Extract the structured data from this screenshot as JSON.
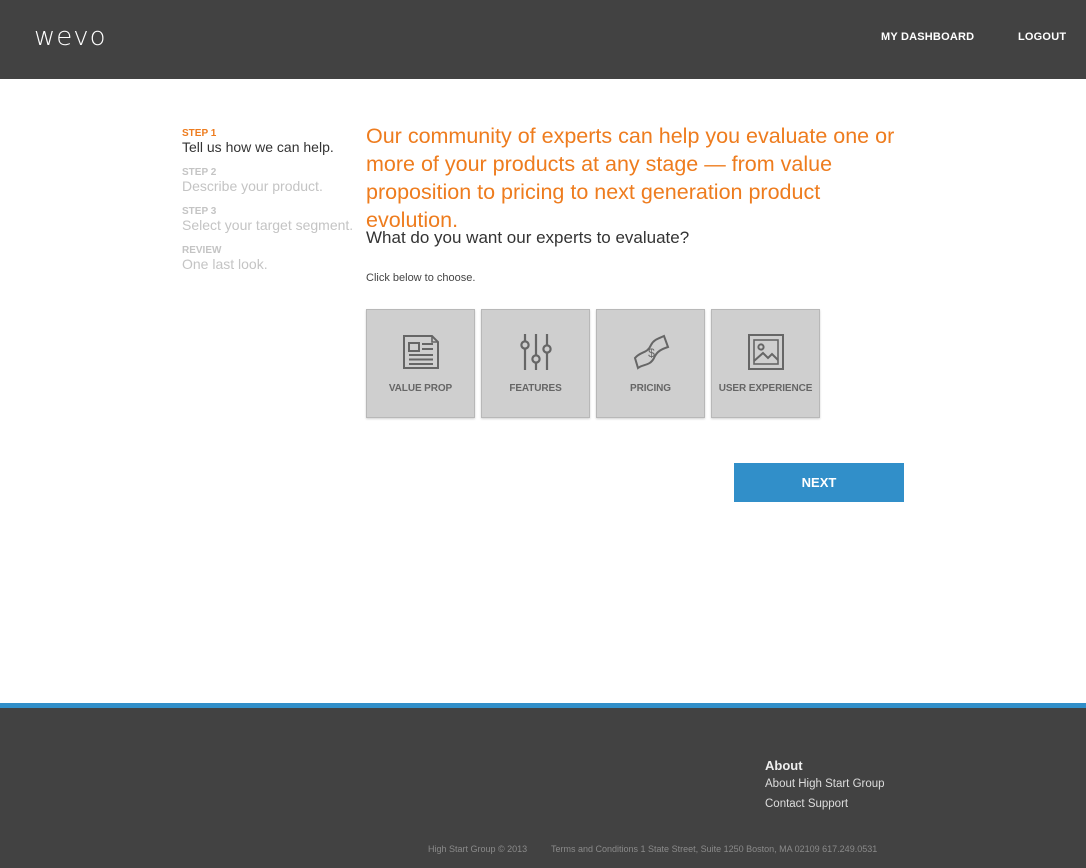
{
  "header": {
    "logo": "wevo",
    "nav": {
      "dashboard": "MY DASHBOARD",
      "logout": "LOGOUT"
    }
  },
  "steps": [
    {
      "label": "STEP 1",
      "description": "Tell us how we can help.",
      "active": true
    },
    {
      "label": "STEP 2",
      "description": "Describe your product.",
      "active": false
    },
    {
      "label": "STEP 3",
      "description": "Select your target segment.",
      "active": false
    },
    {
      "label": "REVIEW",
      "description": "One last look.",
      "active": false
    }
  ],
  "main": {
    "headline": "Our community of experts can help you evaluate one or more of your products at any stage — from value proposition to pricing to next generation product evolution.",
    "question": "What do you want our experts to evaluate?",
    "instruction": "Click below to choose.",
    "options": [
      {
        "label": "VALUE PROP",
        "icon": "newspaper-icon"
      },
      {
        "label": "FEATURES",
        "icon": "sliders-icon"
      },
      {
        "label": "PRICING",
        "icon": "money-bill-icon"
      },
      {
        "label": "USER EXPERIENCE",
        "icon": "image-icon"
      }
    ],
    "next_label": "NEXT"
  },
  "footer": {
    "heading": "About",
    "links": [
      "About High Start Group",
      "Contact Support"
    ],
    "copyright": "High Start Group © 2013",
    "legal": "Terms and Conditions 1 State Street, Suite 1250 Boston, MA 02109 617.249.0531"
  },
  "colors": {
    "header_bg": "#424242",
    "accent_orange": "#ee7c1e",
    "accent_blue": "#318fc9",
    "tile_bg": "#cfcfcf",
    "footer_bg": "#424242"
  }
}
